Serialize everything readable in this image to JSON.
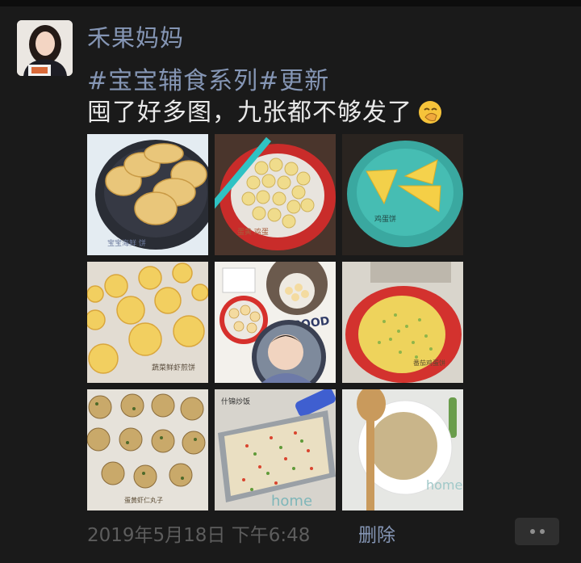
{
  "post": {
    "username": "禾果妈妈",
    "hashtag_1": "#宝宝辅食系列",
    "hashtag_2": "#更新",
    "text": "囤了好多图，九张都不够发了",
    "emoji": "face-with-hand-over-mouth-icon"
  },
  "photos": [
    {
      "label": "宝宝海鲜 饼"
    },
    {
      "label": "蛋黄 鸡蛋"
    },
    {
      "label": "鸡蛋饼"
    },
    {
      "label": "蔬菜鲜虾煎饼"
    },
    {
      "label": "GOOD"
    },
    {
      "label": "番茄鸡蛋饼"
    },
    {
      "label": "蛋黄虾仁丸子"
    },
    {
      "label": "什锦炒饭"
    },
    {
      "label": "home"
    }
  ],
  "footer": {
    "timestamp": "2019年5月18日 下午6:48",
    "delete_label": "删除",
    "more_icon": "more-dots-icon"
  },
  "colors": {
    "background": "#1a1a1a",
    "link": "#8596b5",
    "text": "#e9e9e9",
    "muted": "#5d5d5d"
  }
}
